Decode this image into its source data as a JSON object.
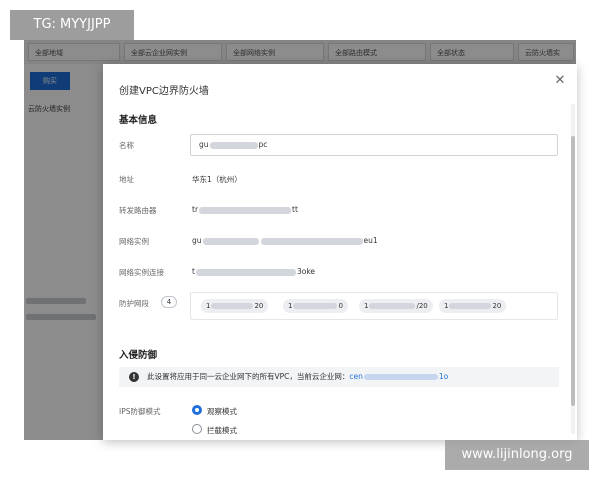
{
  "background": {
    "filters": [
      "全部地域",
      "全部云企业网实例",
      "全部网络实例",
      "全部路由模式",
      "全部状态",
      "云防火墙实"
    ],
    "primary_button": "购买",
    "list_label": "云防火墙实例"
  },
  "modal": {
    "title": "创建VPC边界防火墙",
    "basic_section": "基本信息",
    "fields": {
      "name_label": "名称",
      "name_value_prefix": "gu",
      "name_value_suffix": "pc",
      "address_label": "地址",
      "address_value": "华东1（杭州）",
      "router_label": "转发路由器",
      "router_value_prefix": "tr",
      "router_value_suffix": "tt",
      "instance_label": "网络实例",
      "instance_value_prefix": "gu",
      "instance_value_suffix": "eu1",
      "connection_label": "网络实例连接",
      "connection_value_prefix": "t",
      "connection_value_suffix": "3oke",
      "cidr_label": "防护网段",
      "cidr_count": "4",
      "cidrs": [
        {
          "prefix": "1",
          "suffix": "20"
        },
        {
          "prefix": "1",
          "suffix": "0"
        },
        {
          "prefix": "1",
          "suffix": "/20"
        },
        {
          "prefix": "1",
          "suffix": "20"
        }
      ]
    },
    "intrusion_section": "入侵防御",
    "info": {
      "icon": "info-icon",
      "text": "此设置将应用于同一云企业网下的所有VPC，当前云企业网：",
      "link_prefix": "cen",
      "link_suffix": "1o"
    },
    "ips_label": "IPS防御模式",
    "ips_options": [
      "观察模式",
      "拦截模式"
    ],
    "ips_selected": "观察模式",
    "close_icon": "close-icon",
    "accent_color": "#1e6fd9"
  },
  "watermarks": {
    "top": "TG: MYYJJPP",
    "bottom": "www.lijinlong.org"
  }
}
